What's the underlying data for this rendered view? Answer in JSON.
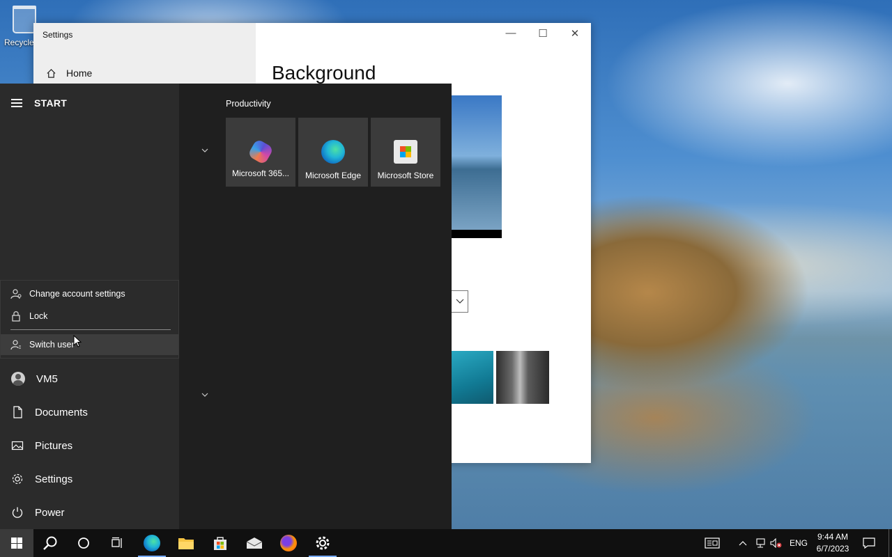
{
  "desktop": {
    "recycle_bin_label": "Recycle"
  },
  "settings_window": {
    "title": "Settings",
    "home_label": "Home",
    "heading": "Background",
    "controls": {
      "minimize": "—",
      "maximize": "☐",
      "close": "✕"
    }
  },
  "start_menu": {
    "title": "START",
    "account_menu": {
      "items": [
        {
          "label": "Change account settings",
          "icon": "person-gear-icon"
        },
        {
          "label": "Lock",
          "icon": "lock-icon"
        },
        {
          "label": "Switch user",
          "icon": "switch-user-icon"
        }
      ]
    },
    "rail": {
      "user": "VM5",
      "documents": "Documents",
      "pictures": "Pictures",
      "settings": "Settings",
      "power": "Power"
    },
    "group_title": "Productivity",
    "tiles": [
      {
        "label": "Microsoft 365...",
        "icon": "microsoft-365-icon"
      },
      {
        "label": "Microsoft Edge",
        "icon": "edge-icon"
      },
      {
        "label": "Microsoft Store",
        "icon": "store-icon"
      }
    ]
  },
  "taskbar": {
    "apps": [
      "start",
      "search",
      "cortana",
      "task-view",
      "edge",
      "file-explorer",
      "store",
      "mail",
      "firefox",
      "settings"
    ],
    "tray": {
      "language": "ENG",
      "time": "9:44 AM",
      "date": "6/7/2023"
    }
  }
}
